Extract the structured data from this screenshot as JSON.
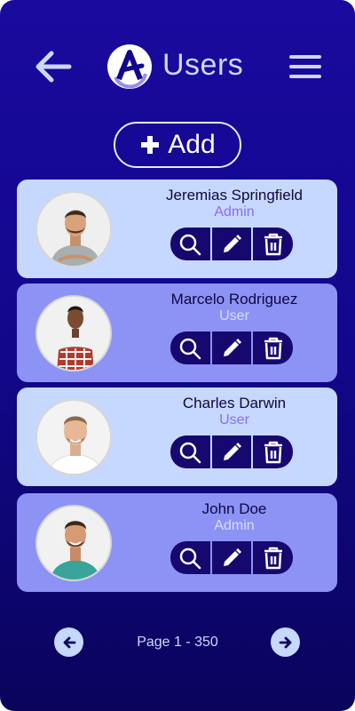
{
  "header": {
    "title": "Users",
    "back_icon": "arrow-left-icon",
    "logo_icon": "app-logo-icon",
    "menu_icon": "hamburger-menu-icon"
  },
  "toolbar": {
    "add_label": "Add",
    "add_icon": "plus-icon"
  },
  "users": [
    {
      "name": "Jeremias Springfield",
      "role": "Admin",
      "card_color": "#c7d8ff"
    },
    {
      "name": "Marcelo Rodriguez",
      "role": "User",
      "card_color": "#8c93f5"
    },
    {
      "name": "Charles Darwin",
      "role": "User",
      "card_color": "#c7d8ff"
    },
    {
      "name": "John Doe",
      "role": "Admin",
      "card_color": "#8c93f5"
    }
  ],
  "actions": {
    "view_icon": "search-icon",
    "edit_icon": "pencil-icon",
    "delete_icon": "trash-icon"
  },
  "pagination": {
    "text": "Page 1 - 350",
    "prev_icon": "arrow-left-icon",
    "next_icon": "arrow-right-icon"
  },
  "colors": {
    "background": "#12078a",
    "accent": "#cdd8ff",
    "button_dark": "#16086e",
    "role_admin": "#8b6cf2"
  }
}
